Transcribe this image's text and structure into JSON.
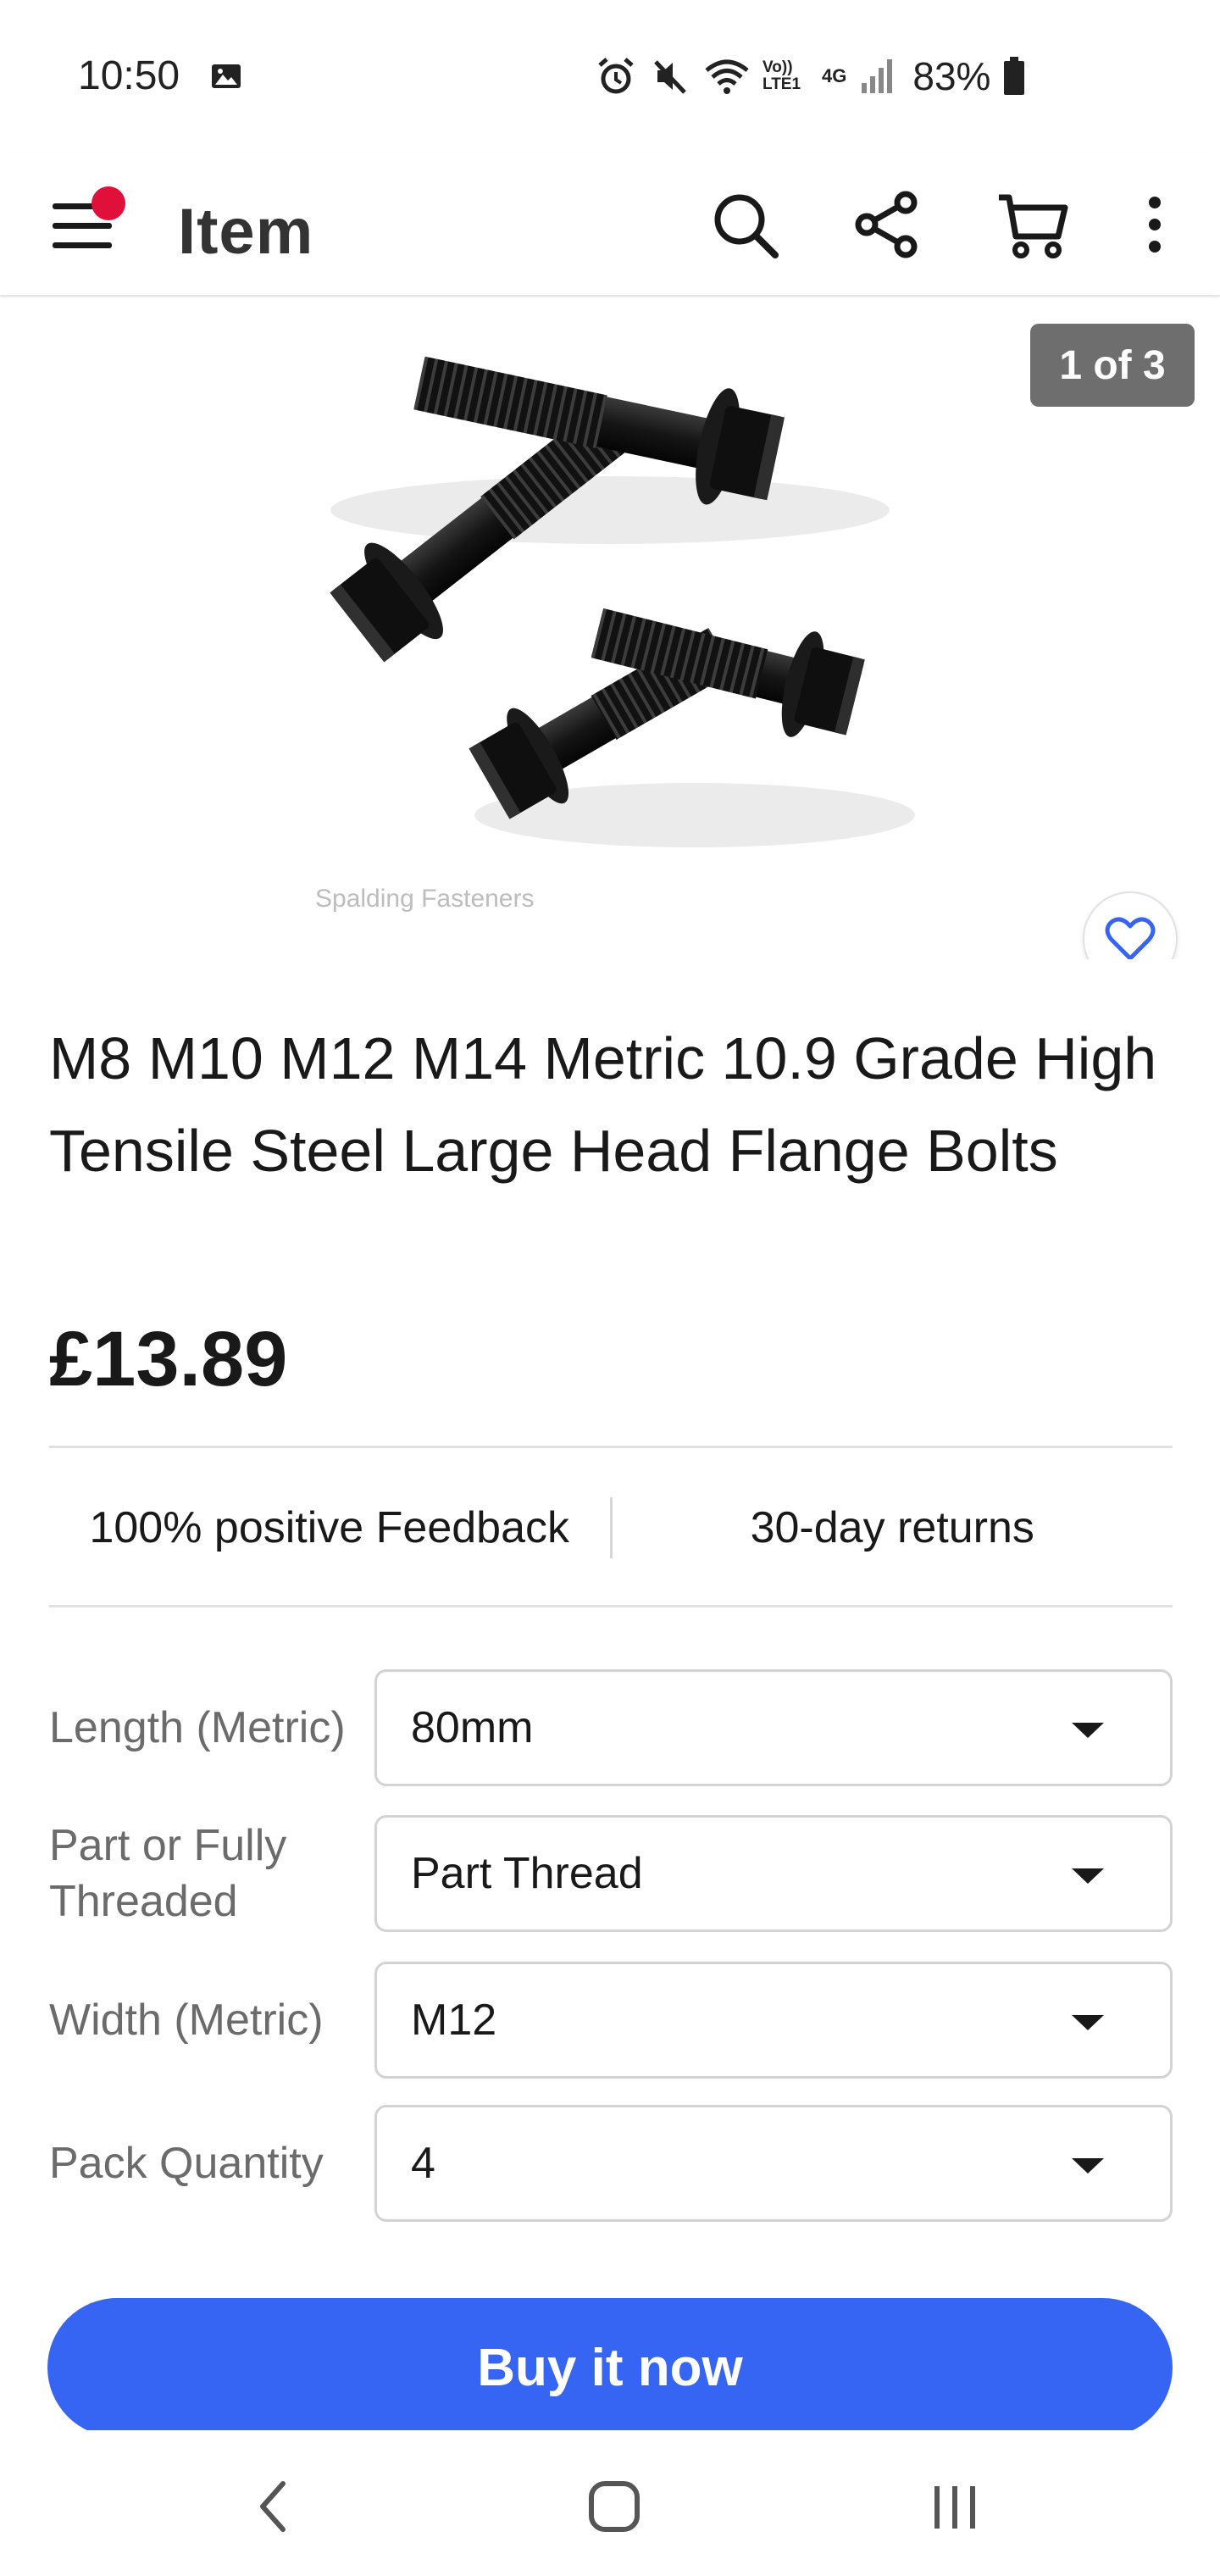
{
  "status_bar": {
    "time": "10:50",
    "battery": "83%",
    "icons": [
      "image-icon",
      "alarm-icon",
      "mute-icon",
      "wifi-icon",
      "volte-icon",
      "4g-icon",
      "signal-icon",
      "battery-icon"
    ],
    "volte_text": "Vo)) LTE1",
    "network_text": "4G"
  },
  "app_bar": {
    "title": "Item",
    "notification_dot_color": "#e0103a",
    "icons": [
      "menu-icon",
      "search-icon",
      "share-icon",
      "cart-icon",
      "more-vert-icon"
    ]
  },
  "gallery": {
    "counter": "1 of 3",
    "watermark": "Spalding Fasteners",
    "favorite_icon": "heart-icon",
    "accent": "#3665f3"
  },
  "listing": {
    "title": "M8 M10 M12 M14 Metric 10.9 Grade High Tensile Steel Large Head Flange Bolts",
    "price": "£13.89"
  },
  "features": {
    "feedback": "100% positive Feedback",
    "returns": "30-day returns"
  },
  "variations": [
    {
      "label": "Length (Metric)",
      "value": "80mm"
    },
    {
      "label": "Part or Fully Threaded",
      "value": "Part Thread"
    },
    {
      "label": "Width (Metric)",
      "value": "M12"
    },
    {
      "label": "Pack Quantity",
      "value": "4"
    }
  ],
  "actions": {
    "buy_now": "Buy it now",
    "buy_color": "#3665f3"
  },
  "nav_bar": {
    "icons": [
      "back-icon",
      "home-icon",
      "recents-icon"
    ]
  }
}
